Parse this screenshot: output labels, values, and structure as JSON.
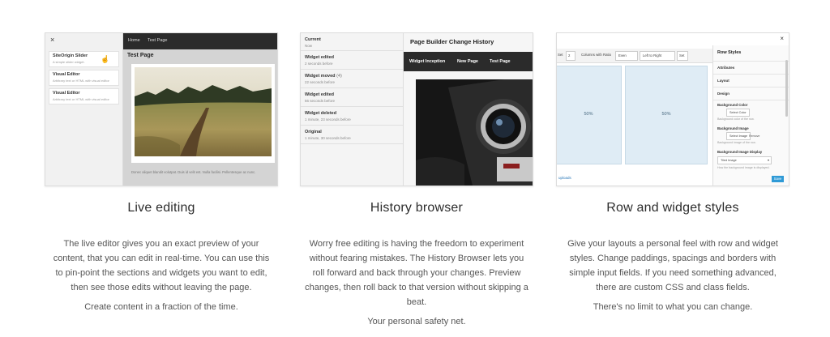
{
  "features": [
    {
      "title": "Live editing",
      "description": "The live editor gives you an exact preview of your content, that you can edit in real-time. You can use this to pin-point the sections and widgets you want to edit, then see those edits without leaving the page.",
      "tagline": "Create content in a fraction of the time.",
      "mock": {
        "close_icon": "×",
        "widgets": [
          {
            "title": "SiteOrigin Slider",
            "subtitle": "A simple slider widget."
          },
          {
            "title": "Visual Editor",
            "subtitle": "Arbitrary text or HTML with visual editor"
          },
          {
            "title": "Visual Editor",
            "subtitle": "Arbitrary text or HTML with visual editor"
          }
        ],
        "nav": [
          "Home",
          "Test Page"
        ],
        "page_title": "Test Page",
        "body_text": "Donec aliquet blandit volutpat. Duis id velit est. Nulla facilisi. Pellentesque ac nunc."
      }
    },
    {
      "title": "History browser",
      "description": "Worry free editing is having the freedom to experiment without fearing mistakes. The History Browser lets you roll forward and back through your changes. Preview changes, then roll back to that version without skipping a beat.",
      "tagline": "Your personal safety net.",
      "mock": {
        "panel_title": "Page Builder Change History",
        "tabs": [
          "Widget Inception",
          "New Page",
          "Test Page"
        ],
        "items": [
          {
            "title": "Current",
            "count": "",
            "time": "Now"
          },
          {
            "title": "Widget edited",
            "count": "",
            "time": "2 seconds before"
          },
          {
            "title": "Widget moved",
            "count": "(4)",
            "time": "22 seconds before"
          },
          {
            "title": "Widget edited",
            "count": "",
            "time": "56 seconds before"
          },
          {
            "title": "Widget deleted",
            "count": "",
            "time": "1 minute, 23 seconds before"
          },
          {
            "title": "Original",
            "count": "",
            "time": "1 minute, 30 seconds before"
          }
        ]
      }
    },
    {
      "title": "Row and widget styles",
      "description": "Give your layouts a personal feel with row and widget styles. Change paddings, spacings and borders with simple input fields. If you need something advanced, there are custom CSS and class fields.",
      "tagline": "There's no limit to what you can change.",
      "mock": {
        "close_icon": "×",
        "toolbar": {
          "set_label": "Set",
          "cols_value": "2",
          "ratio_label": "Columns with Ratio",
          "ratio_value": "Even",
          "direction_value": "Left to Right",
          "set_button": "Set"
        },
        "cells": [
          "50%",
          "50%"
        ],
        "uploads_label": "uploads",
        "panel_title": "Row Styles",
        "sections": [
          "Attributes",
          "Layout",
          "Design"
        ],
        "bg_color_label": "Background Color",
        "bg_color_button": "Select Color",
        "bg_color_hint": "Background color of the row.",
        "bg_image_label": "Background Image",
        "bg_image_button": "Select Image",
        "bg_image_remove": "Remove",
        "bg_image_hint": "Background image of the row.",
        "bg_display_label": "Background Image Display",
        "bg_display_value": "Tiled Image",
        "bg_display_hint": "How the background image is displayed.",
        "save_label": "Save"
      }
    }
  ]
}
